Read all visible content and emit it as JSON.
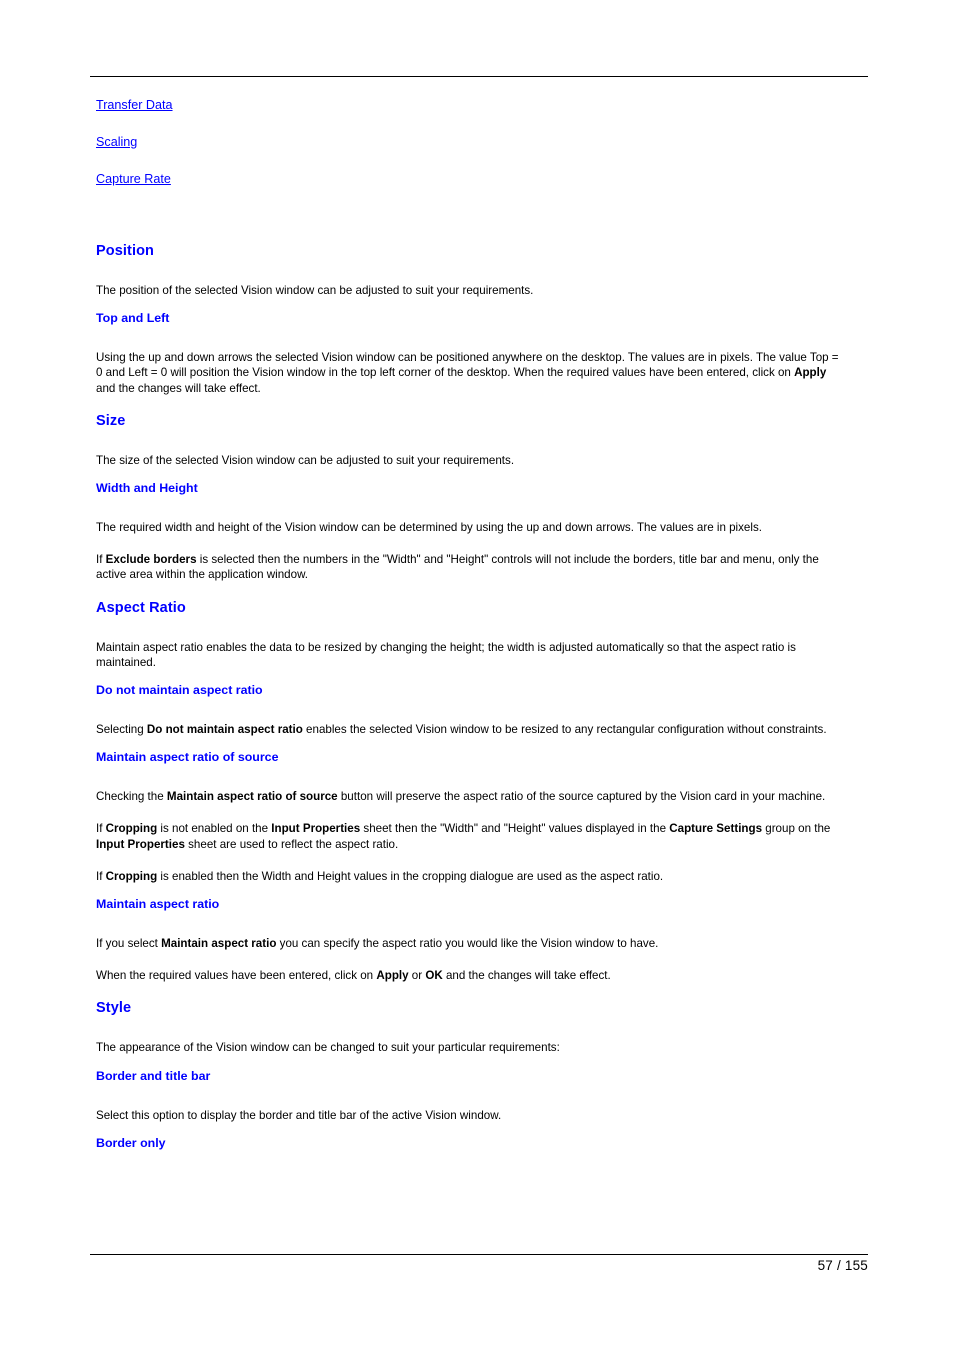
{
  "document": {
    "footer_page": "57 / 155",
    "links": [
      {
        "label": "Transfer Data"
      },
      {
        "label": "Scaling"
      },
      {
        "label": "Capture Rate"
      }
    ],
    "sections": {
      "position": {
        "heading": "Position",
        "intro": "The position of the selected Vision window can be adjusted to suit your requirements.",
        "top_and_left": {
          "heading": "Top and Left",
          "para_a": "Using the up and down arrows the selected Vision window can be positioned anywhere on the desktop. The values are in pixels. The value Top = 0 and Left = 0 will position the Vision window in the top left corner of the desktop. When the required values have been entered, click on ",
          "para_a_bold": "Apply",
          "para_a_tail": " and the changes will take effect."
        }
      },
      "size": {
        "heading": "Size",
        "intro": "The size of the selected Vision window can be adjusted to suit your requirements.",
        "width_and_height": {
          "heading": "Width and Height",
          "para_a": "The required width and height of the Vision window can be determined by using the up and down arrows. The values are in pixels.",
          "para_b_lead": "If ",
          "para_b_bold": "Exclude borders",
          "para_b_tail": " is selected then the numbers in the \"Width\" and \"Height\" controls will not include the borders, title bar and menu, only the active area within the application window."
        }
      },
      "aspect_ratio": {
        "heading": "Aspect Ratio",
        "intro": "Maintain aspect ratio enables the data to be resized by changing the height; the width is adjusted automatically so that the aspect ratio is maintained.",
        "do_not_maintain": {
          "heading": "Do not maintain aspect ratio",
          "para_lead": "Selecting ",
          "para_bold": "Do not maintain aspect ratio",
          "para_tail": " enables the selected Vision window to be resized to any rectangular configuration without constraints."
        },
        "maintain_of_source": {
          "heading": "Maintain aspect ratio of source",
          "para_a_lead": "Checking the ",
          "para_a_bold": "Maintain aspect ratio of source",
          "para_a_tail": " button will preserve the aspect ratio of the source captured by the Vision card in your machine.",
          "para_b_lead": "If ",
          "para_b_bold1": "Cropping",
          "para_b_mid1": " is not enabled on the ",
          "para_b_bold2": "Input Properties",
          "para_b_mid2": " sheet then the \"Width\" and \"Height\" values displayed in the ",
          "para_b_bold3": "Capture Settings",
          "para_b_mid3": " group on the ",
          "para_b_bold4": "Input Properties",
          "para_b_tail": " sheet are used to reflect the aspect ratio.",
          "para_c_lead": "If ",
          "para_c_bold": "Cropping",
          "para_c_tail": " is enabled then the Width and Height values in the cropping dialogue are used as the aspect ratio."
        },
        "maintain": {
          "heading": "Maintain aspect ratio",
          "para_a_lead": "If you select ",
          "para_a_bold": "Maintain aspect ratio",
          "para_a_tail": " you can specify the aspect ratio you would like the Vision window to have.",
          "para_b_lead": "When the required values have been entered, click on ",
          "para_b_bold1": "Apply",
          "para_b_mid": " or ",
          "para_b_bold2": "OK",
          "para_b_tail": " and the changes will take effect."
        }
      },
      "style": {
        "heading": "Style",
        "intro": "The appearance of the Vision window can be changed to suit your particular requirements:",
        "border_and_title_bar": {
          "heading": "Border and title bar",
          "para": "Select this option to display the border and title bar of the active Vision window."
        },
        "border_only": {
          "heading": "Border only"
        }
      }
    }
  }
}
